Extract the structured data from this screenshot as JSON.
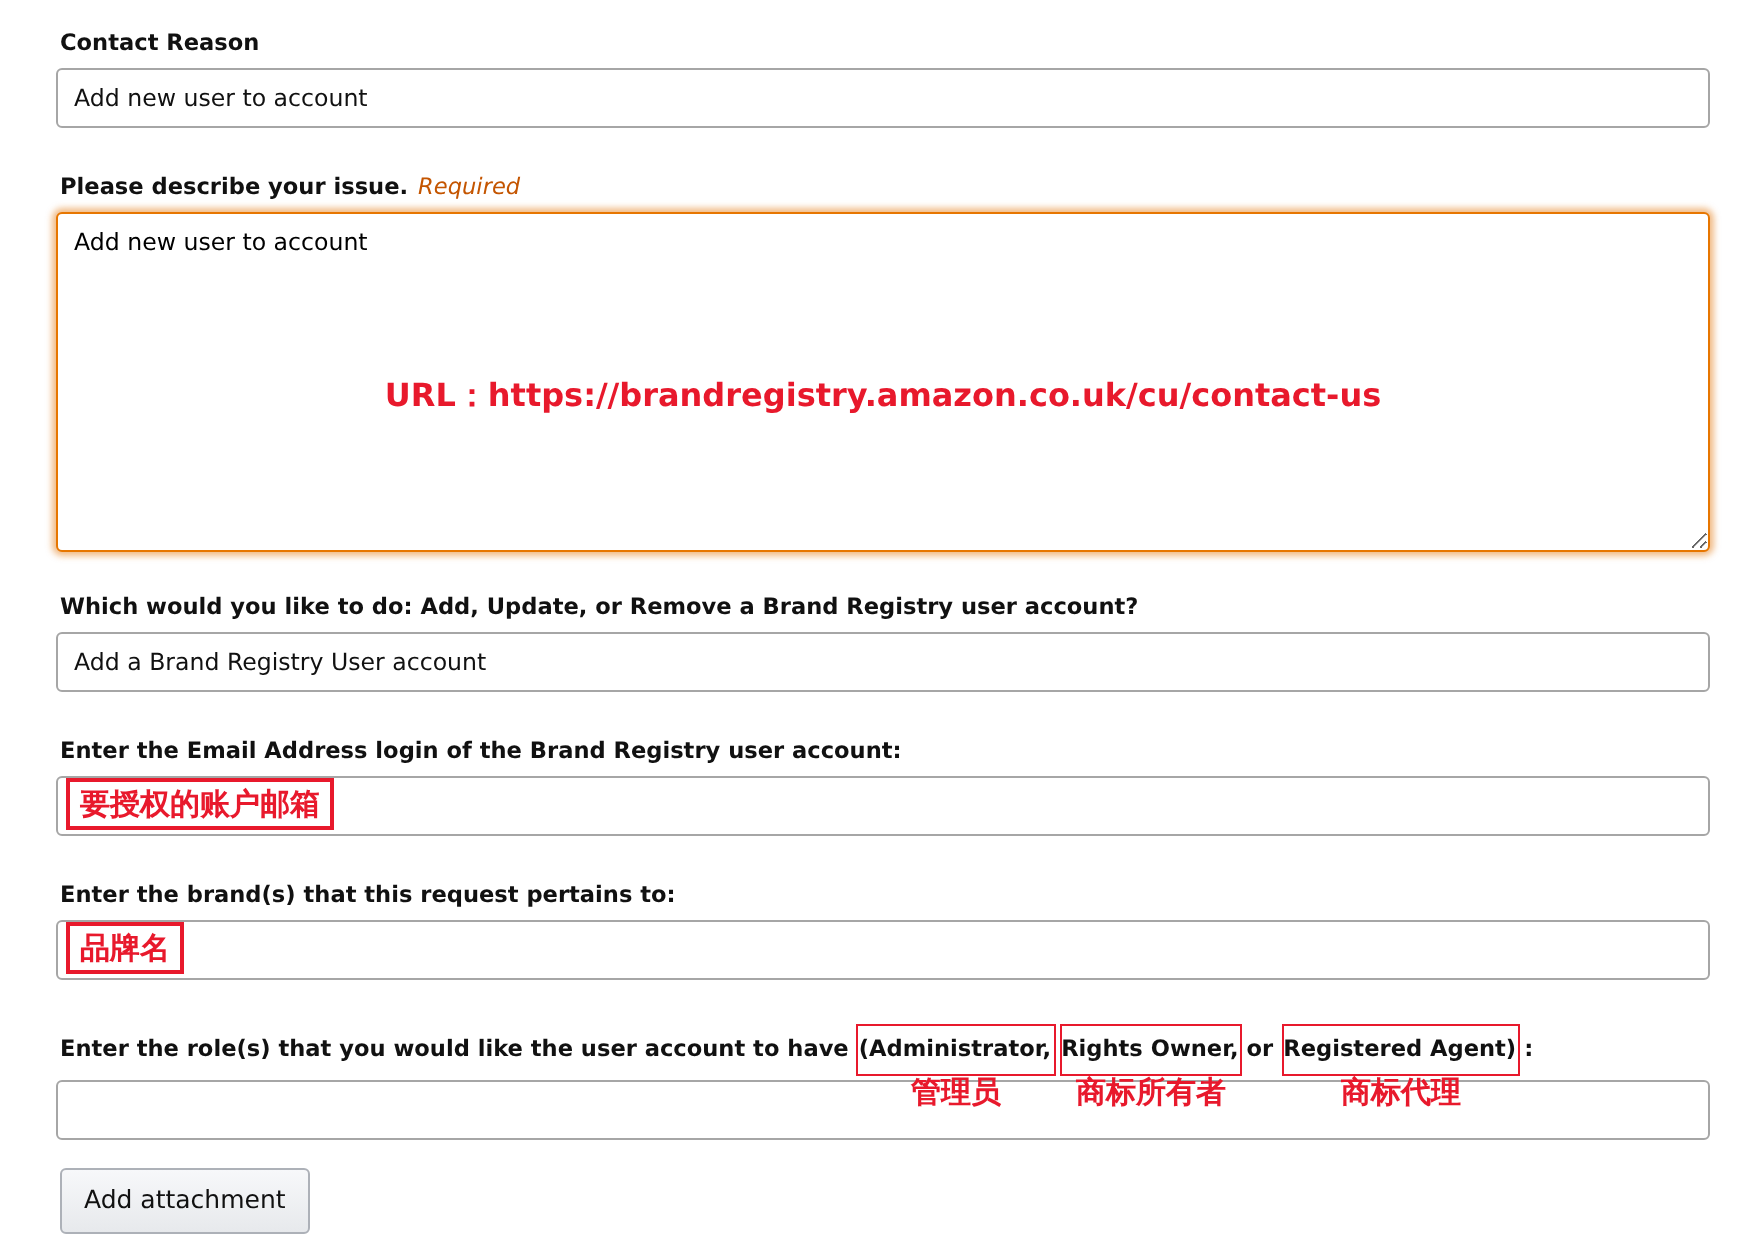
{
  "contact_reason": {
    "label": "Contact Reason",
    "value": "Add new user to account"
  },
  "issue": {
    "label": "Please describe your issue.",
    "required": "Required",
    "value": "Add new user to account",
    "focused": true,
    "annotation": "URL：https://brandregistry.amazon.co.uk/cu/contact-us"
  },
  "action": {
    "label": "Which would you like to do: Add, Update, or Remove a Brand Registry user account?",
    "value": "Add a Brand Registry User account"
  },
  "email": {
    "label": "Enter the Email Address login of the Brand Registry user account:",
    "annotation": "要授权的账户邮箱"
  },
  "brand": {
    "label": "Enter the brand(s) that this request pertains to:",
    "annotation": "品牌名"
  },
  "roles": {
    "label_parts": [
      {
        "text": "Enter the role(s) that you would like the user account to have",
        "boxed": false
      },
      {
        "text": "(Administrator,",
        "boxed": true,
        "note": "管理员"
      },
      {
        "text": "Rights Owner,",
        "boxed": true,
        "note": "商标所有者"
      },
      {
        "text": "or",
        "boxed": false
      },
      {
        "text": "Registered Agent)",
        "boxed": true,
        "note": "商标代理"
      },
      {
        "text": ":",
        "boxed": false
      }
    ]
  },
  "button": "Add attachment"
}
